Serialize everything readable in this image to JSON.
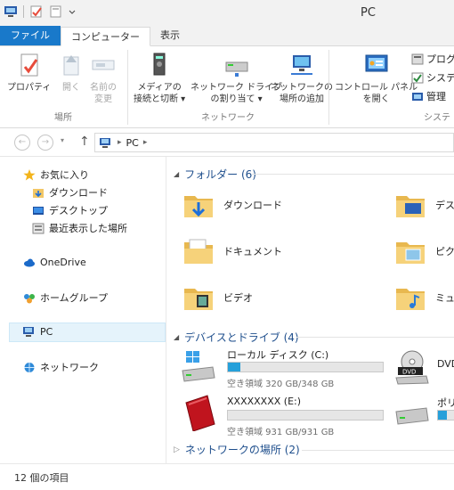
{
  "window": {
    "title": "PC"
  },
  "ribbon_tabs": [
    "ファイル",
    "コンピューター",
    "表示"
  ],
  "ribbon": {
    "groups": {
      "location": "場所",
      "network": "ネットワーク",
      "system": "システ"
    },
    "buttons": {
      "properties": "プロパティ",
      "open": "開く",
      "rename_line1": "名前の",
      "rename_line2": "変更",
      "media_line1": "メディアの",
      "media_line2": "接続と切断 ▾",
      "map_drive_line1": "ネットワーク ドライブ",
      "map_drive_line2": "の割り当て ▾",
      "add_location_line1": "ネットワークの",
      "add_location_line2": "場所の追加",
      "control_panel_line1": "コントロール パネル",
      "control_panel_line2": "を開く",
      "programs": "プログラ",
      "system": "システ",
      "manage": "管理"
    }
  },
  "address": {
    "path": "PC"
  },
  "nav": {
    "favorites": "お気に入り",
    "downloads": "ダウンロード",
    "desktop": "デスクトップ",
    "recent": "最近表示した場所",
    "onedrive": "OneDrive",
    "homegroup": "ホームグループ",
    "pc": "PC",
    "network": "ネットワーク"
  },
  "content": {
    "folders_header": "フォルダー (6)",
    "folders": [
      "ダウンロード",
      "デス",
      "ドキュメント",
      "ピクチ",
      "ビデオ",
      "ミュー"
    ],
    "devices_header": "デバイスとドライブ (4)",
    "drives": [
      {
        "name": "ローカル ディスク (C:)",
        "free": "空き領域 320 GB/348 GB",
        "used_fraction": 0.08
      },
      {
        "name": "DVD",
        "free": "",
        "used_fraction": null
      },
      {
        "name": "XXXXXXXX (E:)",
        "free": "空き領域 931 GB/931 GB",
        "used_fraction": 0.0
      },
      {
        "name": "ポリュ",
        "free": "",
        "used_fraction": 0.35
      }
    ],
    "network_header": "ネットワークの場所 (2)"
  },
  "status": {
    "item_count": "12 個の項目"
  },
  "colors": {
    "accent": "#1979ca",
    "folder": "#f2c766",
    "drive_bar": "#26a0da",
    "section_text": "#1e4e8c"
  }
}
